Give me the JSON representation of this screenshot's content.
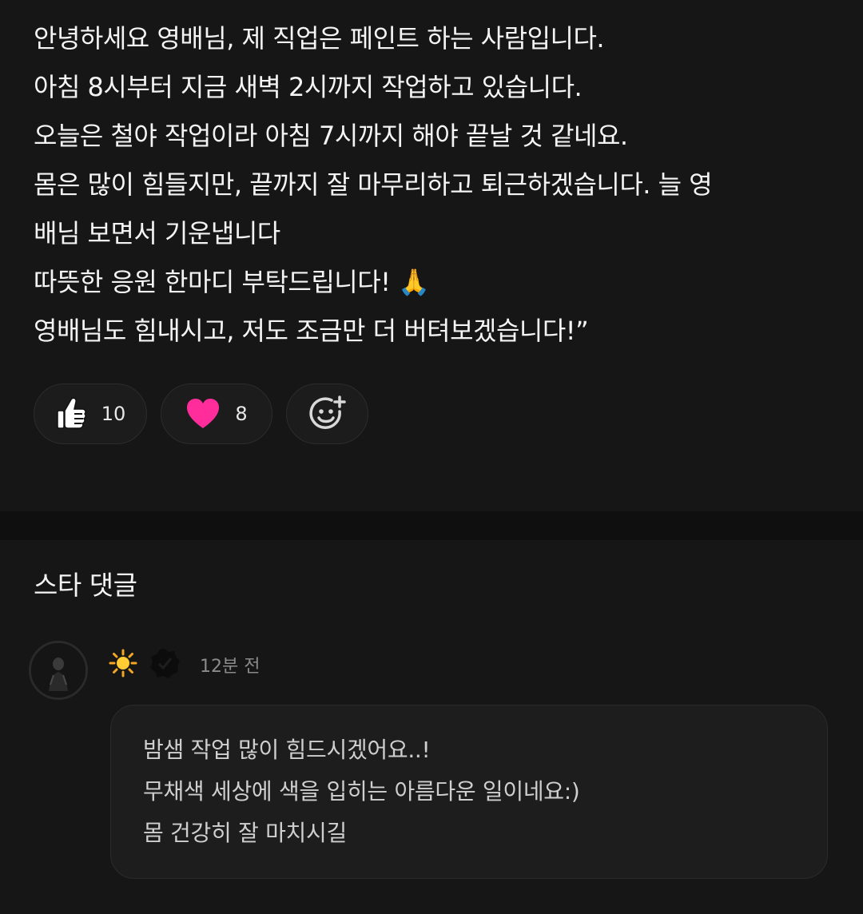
{
  "post": {
    "lines": [
      "안녕하세요 영배님, 제 직업은 페인트 하는 사람입니다.",
      "아침 8시부터 지금 새벽 2시까지 작업하고 있습니다.",
      "오늘은 철야 작업이라 아침 7시까지 해야 끝날 것 같네요.",
      "몸은 많이 힘들지만, 끝까지 잘 마무리하고 퇴근하겠습니다. 늘 영",
      "배님 보면서 기운냅니다",
      "따뜻한 응원 한마디 부탁드립니다! 🙏",
      "영배님도 힘내시고, 저도 조금만 더 버텨보겠습니다!”"
    ],
    "reactions": {
      "like": {
        "icon": "thumbs-up-icon",
        "count": "10"
      },
      "heart": {
        "icon": "heart-icon",
        "count": "8",
        "color": "#ff2d9b"
      },
      "add": {
        "icon": "add-reaction-icon"
      }
    }
  },
  "comments": {
    "title": "스타 댓글",
    "items": [
      {
        "avatar": "avatar",
        "badges": [
          "sun-emoji-icon",
          "verified-badge-icon"
        ],
        "time": "12분 전",
        "lines": [
          "밤샘 작업 많이 힘드시겠어요..!",
          "무채색 세상에 색을 입히는 아름다운 일이네요:)",
          "몸 건강히 잘 마치시길"
        ]
      }
    ]
  },
  "colors": {
    "background": "#121212",
    "surface": "#161616",
    "bubble": "#1d1d1d",
    "heart": "#ff2d9b",
    "sun": "#f5a623"
  }
}
